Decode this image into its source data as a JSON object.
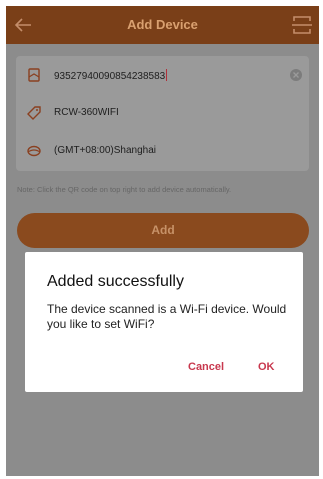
{
  "header": {
    "title": "Add Device",
    "back_icon": "back-arrow-icon",
    "scan_icon": "qr-scan-icon"
  },
  "form": {
    "serial": {
      "value": "93527940090854238583",
      "icon": "document-icon"
    },
    "model": {
      "value": "RCW-360WIFI",
      "icon": "tag-icon"
    },
    "timezone": {
      "value": "(GMT+08:00)Shanghai",
      "icon": "globe-icon"
    }
  },
  "note": "Note: Click the QR code on top right to add device automatically.",
  "add_button": "Add",
  "dialog": {
    "title": "Added successfully",
    "message": "The device scanned is a Wi-Fi device. Would you like to set WiFi?",
    "cancel_label": "Cancel",
    "ok_label": "OK"
  },
  "colors": {
    "header": "#7a3f18",
    "accent": "#c8384e",
    "overlay": "#8c8c8c",
    "icon": "#8a4020"
  }
}
